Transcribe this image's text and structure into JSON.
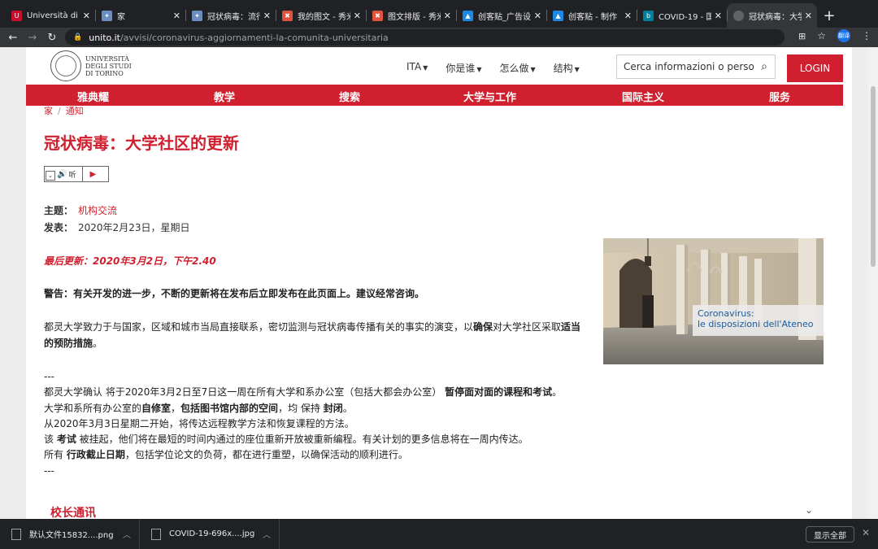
{
  "browser": {
    "tabs": [
      {
        "title": "Università di Pa",
        "favicon_color": "#c8102e"
      },
      {
        "title": "家",
        "favicon_color": "#6c8ebf"
      },
      {
        "title": "冠状病毒：流行",
        "favicon_color": "#6c8ebf"
      },
      {
        "title": "我的图文 - 秀米",
        "favicon_color": "#e0533f"
      },
      {
        "title": "图文排版 - 秀米",
        "favicon_color": "#e0533f"
      },
      {
        "title": "创客贴_广告设计",
        "favicon_color": "#1e88e5"
      },
      {
        "title": "创客贴 - 制作",
        "favicon_color": "#1e88e5"
      },
      {
        "title": "COVID-19 - 国际",
        "favicon_color": "#00809d"
      },
      {
        "title": "冠状病毒：大学",
        "favicon_color": "#5f6368"
      }
    ],
    "address_host": "unito.it",
    "address_path": "/avvisi/coronavirus-aggiornamenti-la-comunita-universitaria",
    "profile_label": "翻译"
  },
  "site": {
    "logo_lines": [
      "UNIVERSITÀ",
      "DEGLI STUDI",
      "DI TORINO"
    ],
    "nav": [
      "ITA",
      "你是谁",
      "怎么做",
      "结构"
    ],
    "search_placeholder": "Cerca informazioni o persone",
    "login": "LOGIN",
    "rednav": [
      "雅典耀",
      "教学",
      "搜索",
      "大学与工作",
      "国际主义",
      "服务"
    ]
  },
  "article": {
    "breadcrumb": [
      "家",
      "通知"
    ],
    "title": "冠状病毒：大学社区的更新",
    "listen_label": "听",
    "topic_label": "主题：",
    "topic_value": "机构交流",
    "published_label": "发表：",
    "published_value": "2020年2月23日，星期日",
    "last_update": "最后更新：2020年3月2日，下午2.40",
    "warning": "警告：有关开发的进一步，不断的更新将在发布后立即发布在此页面上。建议经常咨询。",
    "para1_a": "都灵大学致力于与国家，区域和城市当局直接联系，密切监测与冠状病毒传播有关的事实的演变，以",
    "para1_b": "确保",
    "para1_c": "对大学社区采取",
    "para1_d": "适当的预防措施",
    "para1_e": "。",
    "divider": "---",
    "l1_a": "都灵大学确认 将于2020年3月2日至7日这一周在所有大学和系办公室（包括大都会办公室） ",
    "l1_b": "暂停面对面的课程和考试",
    "l1_c": "。",
    "l2_a": " 大学和系所有办公室的",
    "l2_b": "自修室",
    "l2_c": "，",
    "l2_d": "包括图书馆内部的空间",
    "l2_e": "，均 保持 ",
    "l2_f": "封闭",
    "l2_g": "。",
    "l3": "从2020年3月3日星期二开始，将传达远程教学方法和恢复课程的方法。",
    "l4_a": "该 ",
    "l4_b": "考试",
    "l4_c": " 被挂起，他们将在最短的时间内通过的座位重新开放被重新编程。有关计划的更多信息将在一周内传达。",
    "l5_a": "所有 ",
    "l5_b": "行政截止日期",
    "l5_c": "，包括学位论文的负荷，都在进行重塑，以确保活动的顺利进行。",
    "image_caption_1": "Coronavirus:",
    "image_caption_2": "le disposizioni dell'Ateneo",
    "section_title": "校长通讯"
  },
  "downloads": {
    "items": [
      "默认文件15832....png",
      "COVID-19-696x....jpg"
    ],
    "show_all": "显示全部"
  },
  "colors": {
    "brand_red": "#d01f2e"
  }
}
